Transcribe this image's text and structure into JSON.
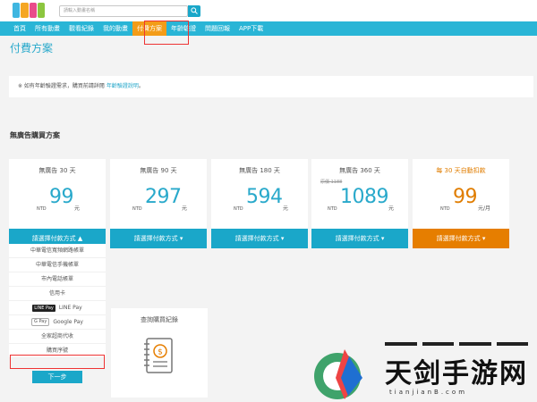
{
  "header": {
    "logo_colors": [
      "#3fb6e0",
      "#f5a623",
      "#e94b8a",
      "#8cc63f"
    ],
    "search_placeholder": "請輸入動畫名稱"
  },
  "nav": {
    "items": [
      {
        "label": "首頁",
        "active": false
      },
      {
        "label": "所有動畫",
        "active": false
      },
      {
        "label": "觀看紀錄",
        "active": false
      },
      {
        "label": "我的動畫",
        "active": false
      },
      {
        "label": "付費方案",
        "active": true
      },
      {
        "label": "年齡驗證",
        "active": false
      },
      {
        "label": "問題回報",
        "active": false
      },
      {
        "label": "APP下載",
        "active": false
      }
    ]
  },
  "page": {
    "title": "付費方案",
    "notice_text": "※ 如有年齡驗證需求，購買前請詳閱",
    "notice_link": "年齡驗證說明",
    "notice_end": "。",
    "section_title": "無廣告購買方案"
  },
  "plans": [
    {
      "name": "無廣告 30 天",
      "currency": "NTD",
      "price": "99",
      "unit": "元",
      "old_price": "",
      "pay_label": "請選擇付款方式",
      "chevron": "▲",
      "highlight": false
    },
    {
      "name": "無廣告 90 天",
      "currency": "NTD",
      "price": "297",
      "unit": "元",
      "old_price": "",
      "pay_label": "請選擇付款方式",
      "chevron": "▾",
      "highlight": false
    },
    {
      "name": "無廣告 180 天",
      "currency": "NTD",
      "price": "594",
      "unit": "元",
      "old_price": "",
      "pay_label": "請選擇付款方式",
      "chevron": "▾",
      "highlight": false
    },
    {
      "name": "無廣告 360 天",
      "currency": "NTD",
      "price": "1089",
      "unit": "元",
      "old_price": "原價 1188",
      "pay_label": "請選擇付款方式",
      "chevron": "▾",
      "highlight": false
    },
    {
      "name": "每 30 天自動扣款",
      "currency": "NTD",
      "price": "99",
      "unit": "元/月",
      "old_price": "",
      "pay_label": "請選擇付款方式",
      "chevron": "▾",
      "highlight": true
    }
  ],
  "payment_methods": [
    {
      "label": "中華電信寬頻網路帳單",
      "badge": ""
    },
    {
      "label": "中華電信手機帳單",
      "badge": ""
    },
    {
      "label": "市內電話帳單",
      "badge": ""
    },
    {
      "label": "信用卡",
      "badge": ""
    },
    {
      "label": "LINE Pay",
      "badge": "LINE Pay"
    },
    {
      "label": "Google Pay",
      "badge": "G Pay"
    },
    {
      "label": "全家超商代收",
      "badge": ""
    },
    {
      "label": "購買序號",
      "badge": ""
    }
  ],
  "next_button": "下一步",
  "record": {
    "title": "查詢購買紀錄"
  },
  "watermark": {
    "text": "天剑手游网",
    "sub": "tianjianB.com"
  },
  "colors": {
    "accent": "#29b5d6",
    "orange": "#e67e00",
    "highlight_box": "#e33333"
  }
}
